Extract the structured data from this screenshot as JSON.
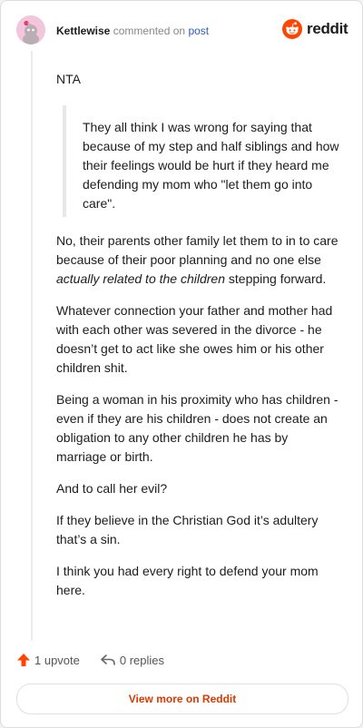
{
  "header": {
    "username": "Kettlewise",
    "action_text": "commented on",
    "post_link": "post",
    "logo_text": "reddit"
  },
  "comment": {
    "first_line": "NTA",
    "quote": "They all think I was wrong for saying that because of my step and half siblings and how their feelings would be hurt if they heard me defending my mom who \"let them go into care\".",
    "p1_start": "No, their parents other family let them to in to care because of their poor planning and no one else ",
    "p1_emphasis": "actually related to the children",
    "p1_end": " stepping forward.",
    "p2": "Whatever connection your father and mother had with each other was severed in the divorce - he doesn’t get to act like she owes him or his other children shit.",
    "p3": "Being a woman in his proximity who has children - even if they are his children - does not create an obligation to any other children he has by marriage or birth.",
    "p4": "And to call her evil?",
    "p5": "If they believe in the Christian God it’s adultery that’s a sin.",
    "p6": "I think you had every right to defend your mom here."
  },
  "actions": {
    "upvote_label": "1 upvote",
    "replies_label": "0 replies"
  },
  "footer": {
    "view_more_label": "View more on Reddit"
  },
  "colors": {
    "accent": "#ff4500",
    "link": "#2f5bbf",
    "view_more": "#d93a00"
  },
  "icons": {
    "avatar": "snoo-avatar",
    "logo": "reddit-snoo-icon",
    "upvote": "upvote-arrow-icon",
    "reply": "reply-arrow-icon"
  }
}
